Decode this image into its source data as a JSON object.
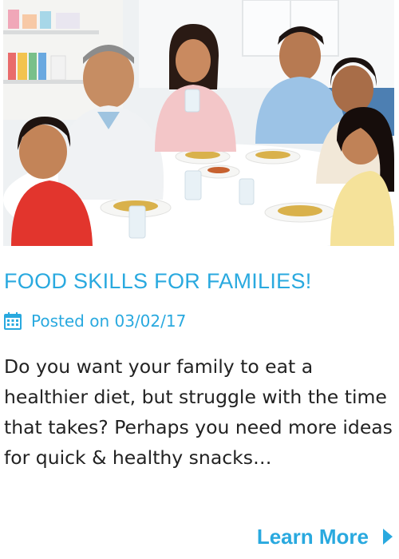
{
  "post": {
    "title": "FOOD SKILLS FOR FAMILIES!",
    "posted": "Posted on 03/02/17",
    "excerpt": "Do you want your family to eat a healthier diet, but struggle with the time that takes? Perhaps you need more ideas for quick & healthy snacks…",
    "learn_more": "Learn More",
    "icon": "calendar-icon",
    "arrow_icon": "triangle-right-icon"
  },
  "colors": {
    "accent": "#29a9df",
    "text": "#222222",
    "background": "#ffffff"
  }
}
